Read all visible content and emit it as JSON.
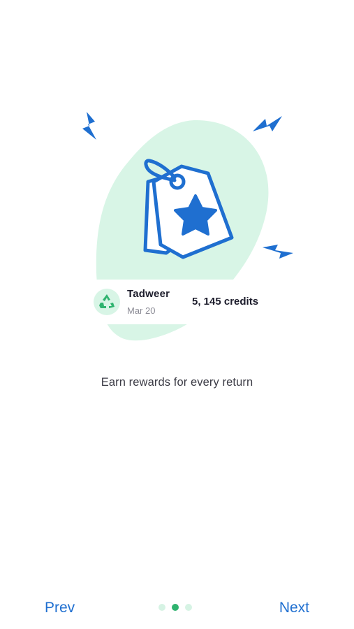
{
  "illustration": {
    "blob_color": "#d8f5e6",
    "accent_color": "#1f6fd0",
    "icons": [
      "lightning-icon",
      "price-tag-icon",
      "star-icon"
    ]
  },
  "reward_card": {
    "icon": "recycle-icon",
    "title": "Tadweer",
    "date": "Mar 20",
    "credits": "5, 145 credits"
  },
  "tagline": "Earn rewards for every return",
  "navigation": {
    "prev_label": "Prev",
    "next_label": "Next",
    "page_count": 3,
    "active_page": 2
  },
  "colors": {
    "primary": "#1f6fd0",
    "dot_active": "#2fb36f",
    "dot_inactive": "#d6f3e4"
  }
}
